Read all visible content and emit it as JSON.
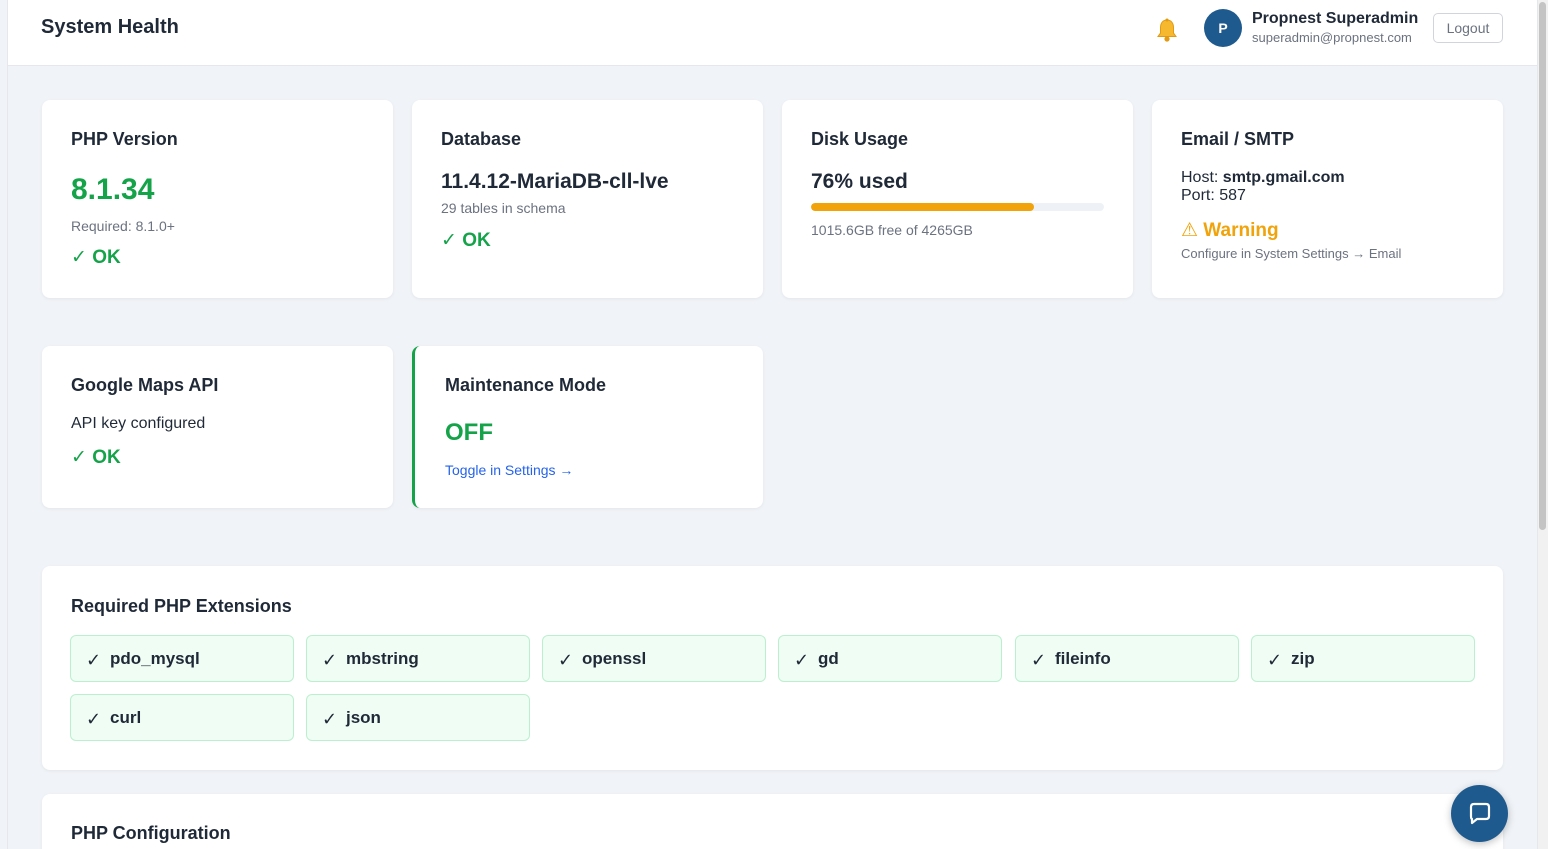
{
  "header": {
    "title": "System Health",
    "user_initial": "P",
    "user_name": "Propnest Superadmin",
    "user_email": "superadmin@propnest.com",
    "logout_label": "Logout"
  },
  "cards": {
    "php": {
      "title": "PHP Version",
      "version": "8.1.34",
      "required": "Required: 8.1.0+",
      "status": "✓ OK"
    },
    "database": {
      "title": "Database",
      "version": "11.4.12-MariaDB-cll-lve",
      "tables": "29 tables in schema",
      "status": "✓ OK"
    },
    "disk": {
      "title": "Disk Usage",
      "used": "76% used",
      "used_fraction": 0.76,
      "free": "1015.6GB free of 4265GB"
    },
    "email": {
      "title": "Email / SMTP",
      "host_label": "Host:",
      "host_value": "smtp.gmail.com",
      "port": "Port: 587",
      "status": "⚠ Warning",
      "hint": "Configure in System Settings → Email"
    },
    "maps": {
      "title": "Google Maps API",
      "text": "API key configured",
      "status": "✓ OK"
    },
    "maintenance": {
      "title": "Maintenance Mode",
      "status": "OFF",
      "link": "Toggle in Settings →"
    }
  },
  "extensions": {
    "title": "Required PHP Extensions",
    "check": "✓",
    "items": [
      "pdo_mysql",
      "mbstring",
      "openssl",
      "gd",
      "fileinfo",
      "zip",
      "curl",
      "json"
    ]
  },
  "config": {
    "title": "PHP Configuration"
  },
  "colors": {
    "ok": "#15a34a",
    "warning": "#f0a30a",
    "link": "#2563eb",
    "brand": "#1e5a8e"
  },
  "icons": {
    "notifications": "bell-icon",
    "chat": "chat-icon"
  }
}
